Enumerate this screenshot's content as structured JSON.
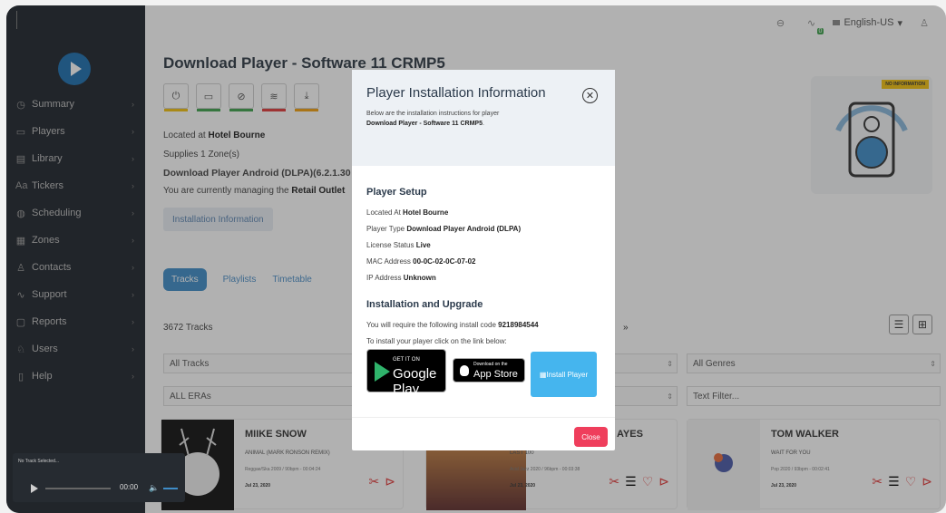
{
  "sidebar": {
    "items": [
      {
        "label": "Summary",
        "icon": "summary-icon",
        "glyph": "◷"
      },
      {
        "label": "Players",
        "icon": "players-icon",
        "glyph": "▭"
      },
      {
        "label": "Library",
        "icon": "library-icon",
        "glyph": "▤"
      },
      {
        "label": "Tickers",
        "icon": "tickers-icon",
        "glyph": "Aa"
      },
      {
        "label": "Scheduling",
        "icon": "scheduling-icon",
        "glyph": "◍"
      },
      {
        "label": "Zones",
        "icon": "zones-icon",
        "glyph": "▦"
      },
      {
        "label": "Contacts",
        "icon": "contacts-icon",
        "glyph": "♙"
      },
      {
        "label": "Support",
        "icon": "support-icon",
        "glyph": "∿"
      },
      {
        "label": "Reports",
        "icon": "reports-icon",
        "glyph": "▢"
      },
      {
        "label": "Users",
        "icon": "users-icon",
        "glyph": "♘"
      },
      {
        "label": "Help",
        "icon": "help-icon",
        "glyph": "▯"
      }
    ]
  },
  "topbar": {
    "language": "English-US",
    "activity_badge": "0"
  },
  "main": {
    "title": "Download Player - Software 11 CRMP5",
    "located_prefix": "Located at",
    "located_value": "Hotel Bourne",
    "supplies": "Supplies 1 Zone(s)",
    "player_type": "Download Player Android (DLPA)(6.2.1.30",
    "managing_prefix": "You are currently managing the",
    "managing_value": "Retail Outlet",
    "install_info_button": "Installation Information",
    "no_information_badge": "NO INFORMATION",
    "tabs": {
      "tracks": "Tracks",
      "playlists": "Playlists",
      "timetable": "Timetable"
    },
    "track_count": "3672 Tracks",
    "pagination_next": "»",
    "filters": {
      "all_tracks": "All Tracks",
      "all_eras": "ALL ERAs",
      "all_genres": "All Genres",
      "text_filter": "Text Filter..."
    },
    "cards": [
      {
        "title": "MIIKE SNOW",
        "subtitle": "ANIMAL (MARK RONSON REMIX)",
        "meta": "Reggae/Ska 2009 / 90bpm - 00:04:24",
        "date": "Jul 23, 2020"
      },
      {
        "title": "AYES",
        "subtitle": "LAST 100",
        "meta": "Acid Jazz 2020 / 96bpm - 00:03:38",
        "date": "Jul 23, 2020"
      },
      {
        "title": "TOM WALKER",
        "subtitle": "WAIT FOR YOU",
        "meta": "Pop 2020 / 93bpm - 00:02:41",
        "date": "Jul 23, 2020"
      }
    ]
  },
  "mini_player": {
    "now_playing": "No Track Selected...",
    "time": "00:00"
  },
  "modal": {
    "title": "Player Installation Information",
    "intro_text": "Below are the installation instructions for player",
    "intro_player": "Download Player - Software 11 CRMP5",
    "setup_title": "Player Setup",
    "located_label": "Located At",
    "located_value": "Hotel Bourne",
    "type_label": "Player Type",
    "type_value": "Download Player Android (DLPA)",
    "license_label": "License Status",
    "license_value": "Live",
    "mac_label": "MAC Address",
    "mac_value": "00-0C-02-0C-07-02",
    "ip_label": "IP Address",
    "ip_value": "Unknown",
    "install_title": "Installation and Upgrade",
    "code_text": "You will require the following install code",
    "code_value": "9218984544",
    "link_text": "To install your player click on the link below:",
    "google_small": "GET IT ON",
    "google_big": "Google Play",
    "apple_small": "Download on the",
    "apple_big": "App Store",
    "install_player": "Install Player",
    "close": "Close"
  },
  "colors": {
    "sidebar": "#1f252c",
    "accent": "#3f8dc8",
    "install_button": "#45b5ee",
    "close_button": "#ef3e5c"
  }
}
